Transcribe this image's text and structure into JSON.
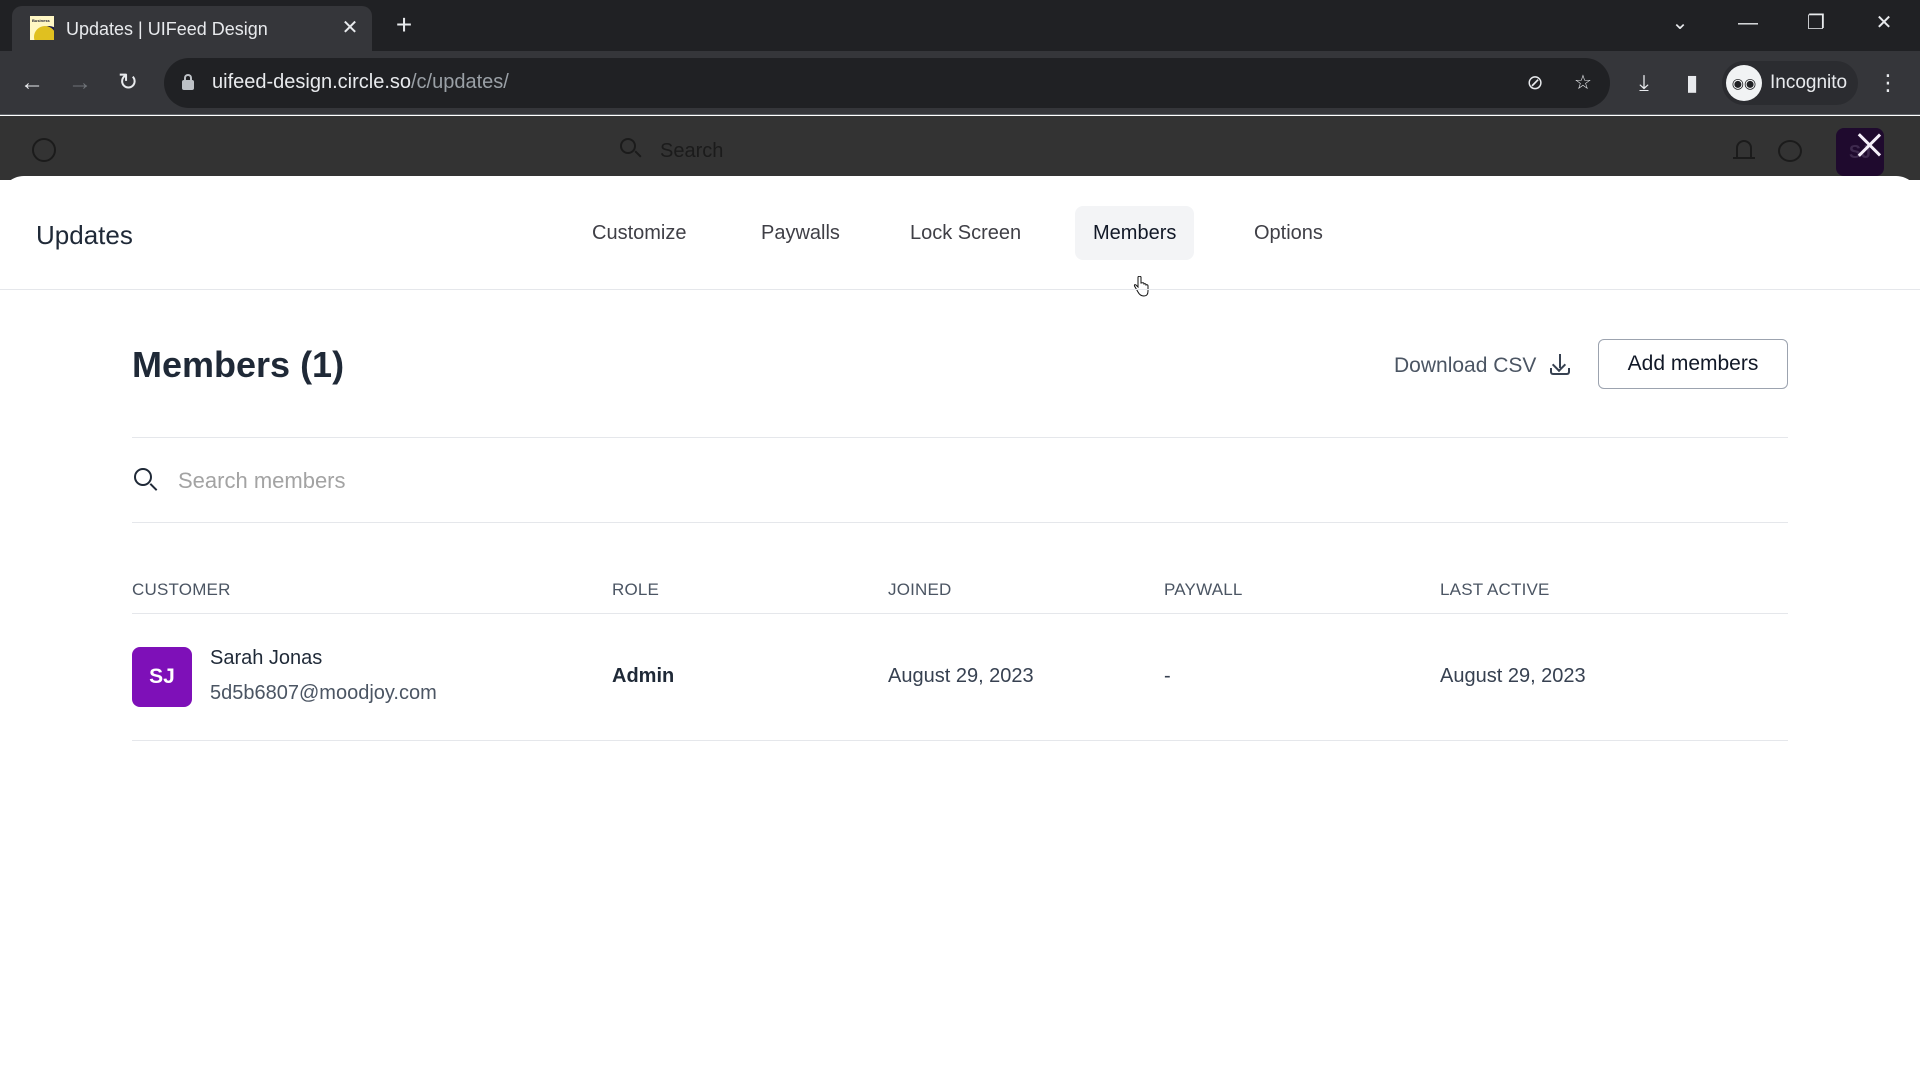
{
  "browser": {
    "tab_title": "Updates | UIFeed Design",
    "favicon_label": "Business",
    "url_host": "uifeed-design.circle.so",
    "url_path": "/c/updates/",
    "profile_label": "Incognito",
    "icons": {
      "back": "←",
      "forward": "→",
      "reload": "↻",
      "tab_close": "✕",
      "new_tab": "+",
      "tab_search": "⌄",
      "minimize": "—",
      "restore": "❐",
      "close": "✕",
      "eye_off": "⊘",
      "star": "☆",
      "download": "⤓",
      "side_panel": "▮",
      "menu": "⋮",
      "incognito": "🕶"
    }
  },
  "app_header": {
    "search_placeholder": "Search",
    "user_initials": "SJ"
  },
  "modal": {
    "title": "Updates",
    "tabs": [
      {
        "label": "Customize",
        "active": false
      },
      {
        "label": "Paywalls",
        "active": false
      },
      {
        "label": "Lock Screen",
        "active": false
      },
      {
        "label": "Members",
        "active": true
      },
      {
        "label": "Options",
        "active": false
      }
    ]
  },
  "members": {
    "title": "Members (1)",
    "download_csv_label": "Download CSV",
    "add_members_label": "Add members",
    "search_placeholder": "Search members",
    "search_value": "",
    "columns": [
      "CUSTOMER",
      "ROLE",
      "JOINED",
      "PAYWALL",
      "LAST ACTIVE"
    ],
    "rows": [
      {
        "initials": "SJ",
        "avatar_color": "#7e10b8",
        "name": "Sarah Jonas",
        "email": "5d5b6807@moodjoy.com",
        "role": "Admin",
        "joined": "August 29, 2023",
        "paywall": "-",
        "last_active": "August 29, 2023"
      }
    ]
  }
}
